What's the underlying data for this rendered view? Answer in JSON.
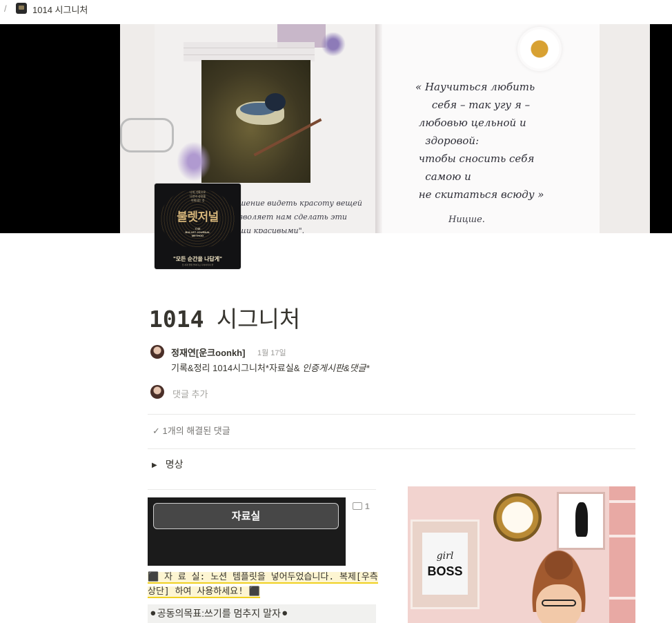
{
  "breadcrumb": {
    "separator": "/",
    "title": "1014 시그니처"
  },
  "cover": {
    "quote_text": "« Научиться любить\n     себя – так угу я –\n любовью цельной и\n   здоровой:\n чтобы сносить себя\n   самою и\n не скитаться всюду »",
    "signature": "Ницше.",
    "scribble_text": "шение видеть красоту вещей\nзволяет нам сделать эти\nщи красивыми\"."
  },
  "icon": {
    "small_lines": [
      "나의 기록으로",
      "나만의 성장을",
      "이뤄내는 것"
    ],
    "title": "불렛저널",
    "subtitle_lines": [
      "THE",
      "BULLET JOURNAL",
      "METHOD"
    ],
    "tagline": "\"모든 순간을 나답게\"",
    "footer": "전 세계 몇몇 돌아다닌 다이어리의 끝"
  },
  "page": {
    "title_num": "1014",
    "title_text": "  시그니처"
  },
  "comment": {
    "author": "정재연[운크oonkh]",
    "date": "1월 17일",
    "text_plain": "기록&정리 1014시그니처*자료실& ",
    "text_italic": "인증게시판&댓글*",
    "add_placeholder": "댓글 추가",
    "resolved_check": "✓",
    "resolved_text": "1개의 해결된 댓글"
  },
  "toggle": {
    "arrow": "▶",
    "label": "명상"
  },
  "callout": {
    "button_label": "자료실",
    "comment_count": "1"
  },
  "note": {
    "line": "⬛ 자 료 실: 노션 템플릿을 넣어두었습니다. 복제[우측상단] 하여 사용하세요! ⬛"
  },
  "goal": {
    "text": "⚫공동의목표:쓰기를 멈추지 말자⚫"
  },
  "illustration": {
    "girl": "girl",
    "boss": "BOSS"
  },
  "colors": {
    "text": "#37352f",
    "muted": "#9b9a97",
    "divider": "#e9e9e7",
    "highlight_bg": "#fdf5d2",
    "highlight_underline": "#f0d020",
    "callout_bg": "#1b1b1b",
    "button_bg": "#474747"
  }
}
